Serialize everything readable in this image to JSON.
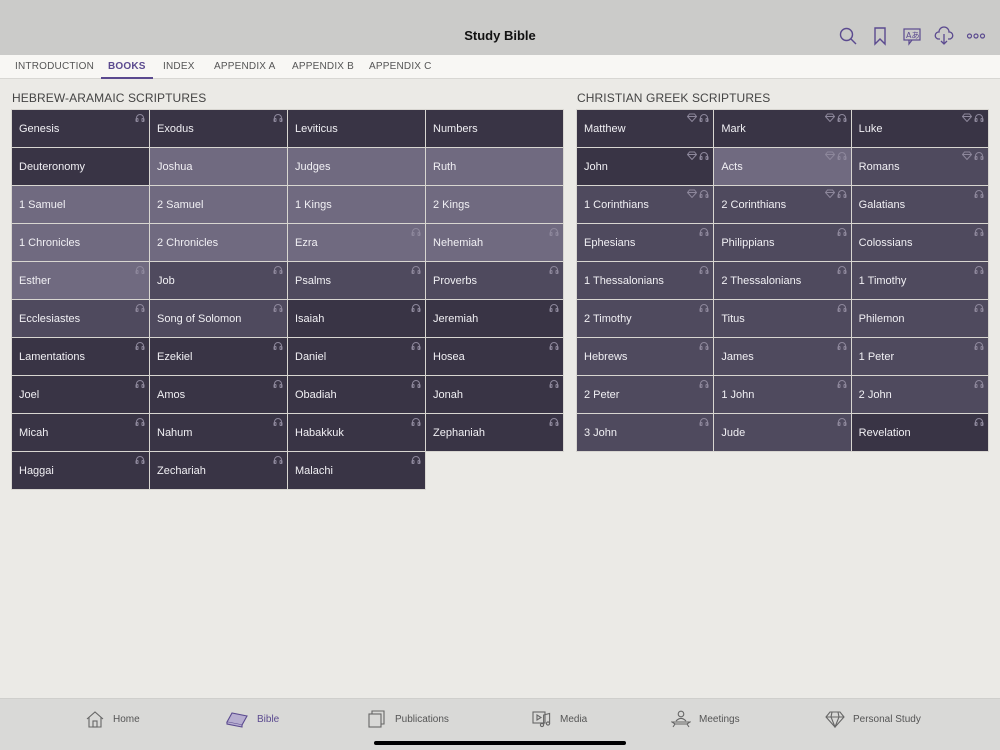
{
  "header": {
    "title": "Study Bible",
    "icons": [
      "search-icon",
      "bookmark-icon",
      "language-icon",
      "download-cloud-icon",
      "more-icon"
    ]
  },
  "tabs": [
    {
      "label": "INTRODUCTION",
      "active": false
    },
    {
      "label": "BOOKS",
      "active": true
    },
    {
      "label": "INDEX",
      "active": false
    },
    {
      "label": "APPENDIX A",
      "active": false
    },
    {
      "label": "APPENDIX B",
      "active": false
    },
    {
      "label": "APPENDIX C",
      "active": false
    }
  ],
  "colors": {
    "accent": "#5b4a8f",
    "cell_dark": "#393445",
    "cell_medium": "#4f4a5e",
    "cell_light": "#706a80"
  },
  "hebrew": {
    "title": "HEBREW-ARAMAIC SCRIPTURES",
    "books": [
      {
        "name": "Genesis",
        "shade": "dark",
        "audio": true,
        "study": false
      },
      {
        "name": "Exodus",
        "shade": "dark",
        "audio": true,
        "study": false
      },
      {
        "name": "Leviticus",
        "shade": "dark",
        "audio": false,
        "study": false
      },
      {
        "name": "Numbers",
        "shade": "dark",
        "audio": false,
        "study": false
      },
      {
        "name": "Deuteronomy",
        "shade": "dark",
        "audio": false,
        "study": false
      },
      {
        "name": "Joshua",
        "shade": "light",
        "audio": false,
        "study": false
      },
      {
        "name": "Judges",
        "shade": "light",
        "audio": false,
        "study": false
      },
      {
        "name": "Ruth",
        "shade": "light",
        "audio": false,
        "study": false
      },
      {
        "name": "1 Samuel",
        "shade": "light",
        "audio": false,
        "study": false
      },
      {
        "name": "2 Samuel",
        "shade": "light",
        "audio": false,
        "study": false
      },
      {
        "name": "1 Kings",
        "shade": "light",
        "audio": false,
        "study": false
      },
      {
        "name": "2 Kings",
        "shade": "light",
        "audio": false,
        "study": false
      },
      {
        "name": "1 Chronicles",
        "shade": "light",
        "audio": false,
        "study": false
      },
      {
        "name": "2 Chronicles",
        "shade": "light",
        "audio": false,
        "study": false
      },
      {
        "name": "Ezra",
        "shade": "light",
        "audio": true,
        "study": false
      },
      {
        "name": "Nehemiah",
        "shade": "light",
        "audio": true,
        "study": false
      },
      {
        "name": "Esther",
        "shade": "light",
        "audio": true,
        "study": false
      },
      {
        "name": "Job",
        "shade": "medium",
        "audio": true,
        "study": false
      },
      {
        "name": "Psalms",
        "shade": "medium",
        "audio": true,
        "study": false
      },
      {
        "name": "Proverbs",
        "shade": "medium",
        "audio": true,
        "study": false
      },
      {
        "name": "Ecclesiastes",
        "shade": "medium",
        "audio": true,
        "study": false
      },
      {
        "name": "Song of Solomon",
        "shade": "medium",
        "audio": true,
        "study": false
      },
      {
        "name": "Isaiah",
        "shade": "dark",
        "audio": true,
        "study": false
      },
      {
        "name": "Jeremiah",
        "shade": "dark",
        "audio": true,
        "study": false
      },
      {
        "name": "Lamentations",
        "shade": "dark",
        "audio": true,
        "study": false
      },
      {
        "name": "Ezekiel",
        "shade": "dark",
        "audio": true,
        "study": false
      },
      {
        "name": "Daniel",
        "shade": "dark",
        "audio": true,
        "study": false
      },
      {
        "name": "Hosea",
        "shade": "dark",
        "audio": true,
        "study": false
      },
      {
        "name": "Joel",
        "shade": "dark",
        "audio": true,
        "study": false
      },
      {
        "name": "Amos",
        "shade": "dark",
        "audio": true,
        "study": false
      },
      {
        "name": "Obadiah",
        "shade": "dark",
        "audio": true,
        "study": false
      },
      {
        "name": "Jonah",
        "shade": "dark",
        "audio": true,
        "study": false
      },
      {
        "name": "Micah",
        "shade": "dark",
        "audio": true,
        "study": false
      },
      {
        "name": "Nahum",
        "shade": "dark",
        "audio": true,
        "study": false
      },
      {
        "name": "Habakkuk",
        "shade": "dark",
        "audio": true,
        "study": false
      },
      {
        "name": "Zephaniah",
        "shade": "dark",
        "audio": true,
        "study": false
      },
      {
        "name": "Haggai",
        "shade": "dark",
        "audio": true,
        "study": false
      },
      {
        "name": "Zechariah",
        "shade": "dark",
        "audio": true,
        "study": false
      },
      {
        "name": "Malachi",
        "shade": "dark",
        "audio": true,
        "study": false
      }
    ]
  },
  "greek": {
    "title": "CHRISTIAN GREEK SCRIPTURES",
    "books": [
      {
        "name": "Matthew",
        "shade": "dark",
        "audio": true,
        "study": true
      },
      {
        "name": "Mark",
        "shade": "dark",
        "audio": true,
        "study": true
      },
      {
        "name": "Luke",
        "shade": "dark",
        "audio": true,
        "study": true
      },
      {
        "name": "John",
        "shade": "dark",
        "audio": true,
        "study": true
      },
      {
        "name": "Acts",
        "shade": "light",
        "audio": true,
        "study": true
      },
      {
        "name": "Romans",
        "shade": "medium",
        "audio": true,
        "study": true
      },
      {
        "name": "1 Corinthians",
        "shade": "medium",
        "audio": true,
        "study": true
      },
      {
        "name": "2 Corinthians",
        "shade": "medium",
        "audio": true,
        "study": true
      },
      {
        "name": "Galatians",
        "shade": "medium",
        "audio": true,
        "study": false
      },
      {
        "name": "Ephesians",
        "shade": "medium",
        "audio": true,
        "study": false
      },
      {
        "name": "Philippians",
        "shade": "medium",
        "audio": true,
        "study": false
      },
      {
        "name": "Colossians",
        "shade": "medium",
        "audio": true,
        "study": false
      },
      {
        "name": "1 Thessalonians",
        "shade": "medium",
        "audio": true,
        "study": false
      },
      {
        "name": "2 Thessalonians",
        "shade": "medium",
        "audio": true,
        "study": false
      },
      {
        "name": "1 Timothy",
        "shade": "medium",
        "audio": true,
        "study": false
      },
      {
        "name": "2 Timothy",
        "shade": "medium",
        "audio": true,
        "study": false
      },
      {
        "name": "Titus",
        "shade": "medium",
        "audio": true,
        "study": false
      },
      {
        "name": "Philemon",
        "shade": "medium",
        "audio": true,
        "study": false
      },
      {
        "name": "Hebrews",
        "shade": "medium",
        "audio": true,
        "study": false
      },
      {
        "name": "James",
        "shade": "medium",
        "audio": true,
        "study": false
      },
      {
        "name": "1 Peter",
        "shade": "medium",
        "audio": true,
        "study": false
      },
      {
        "name": "2 Peter",
        "shade": "medium",
        "audio": true,
        "study": false
      },
      {
        "name": "1 John",
        "shade": "medium",
        "audio": true,
        "study": false
      },
      {
        "name": "2 John",
        "shade": "medium",
        "audio": true,
        "study": false
      },
      {
        "name": "3 John",
        "shade": "medium",
        "audio": true,
        "study": false
      },
      {
        "name": "Jude",
        "shade": "medium",
        "audio": true,
        "study": false
      },
      {
        "name": "Revelation",
        "shade": "dark",
        "audio": true,
        "study": false
      }
    ]
  },
  "bottom_nav": [
    {
      "label": "Home",
      "icon": "home-icon",
      "active": false
    },
    {
      "label": "Bible",
      "icon": "bible-icon",
      "active": true
    },
    {
      "label": "Publications",
      "icon": "publications-icon",
      "active": false
    },
    {
      "label": "Media",
      "icon": "media-icon",
      "active": false
    },
    {
      "label": "Meetings",
      "icon": "meetings-icon",
      "active": false
    },
    {
      "label": "Personal Study",
      "icon": "personal-study-icon",
      "active": false
    }
  ]
}
